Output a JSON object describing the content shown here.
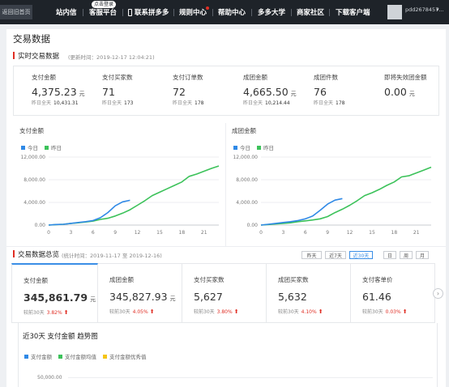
{
  "nav": {
    "home_label": "返回旧首页",
    "items": [
      {
        "label": "站内信"
      },
      {
        "label": "客服平台",
        "badge": "点击登录"
      },
      {
        "label": "联系拼多多"
      },
      {
        "label": "规则中心"
      },
      {
        "label": "帮助中心"
      },
      {
        "label": "多多大学"
      },
      {
        "label": "商家社区"
      },
      {
        "label": "下载客户端"
      }
    ],
    "user_name": "pdd2678457..."
  },
  "page": {
    "title": "交易数据"
  },
  "realtime": {
    "title": "实时交易数据",
    "note": "(更新时间：2019-12-17 12:04:21)",
    "yesterday_label": "昨日全天",
    "metrics": [
      {
        "label": "支付金额",
        "value": "4,375.23",
        "unit": "元",
        "yesterday": "10,431.31"
      },
      {
        "label": "支付买家数",
        "value": "71",
        "unit": "",
        "yesterday": "173"
      },
      {
        "label": "支付订单数",
        "value": "72",
        "unit": "",
        "yesterday": "178"
      },
      {
        "label": "成团金额",
        "value": "4,665.50",
        "unit": "元",
        "yesterday": "10,214.44"
      },
      {
        "label": "成团件数",
        "value": "76",
        "unit": "",
        "yesterday": "178"
      },
      {
        "label": "即将失效团金额",
        "value": "0.00",
        "unit": "元",
        "yesterday": ""
      }
    ]
  },
  "overview": {
    "title": "交易数据总览",
    "note": "(统计时间：2019-11-17 至 2019-12-16)",
    "ranges": [
      "昨天",
      "近7天",
      "近30天",
      "日",
      "周",
      "月"
    ],
    "active_range": "近30天",
    "compare_label": "较前30天",
    "cards": [
      {
        "label": "支付金额",
        "value": "345,861.79",
        "unit": "元",
        "pct": "3.82%"
      },
      {
        "label": "成团金额",
        "value": "345,827.93",
        "unit": "元",
        "pct": "4.05%"
      },
      {
        "label": "支付买家数",
        "value": "5,627",
        "unit": "",
        "pct": "3.80%"
      },
      {
        "label": "成团买家数",
        "value": "5,632",
        "unit": "",
        "pct": "4.10%"
      },
      {
        "label": "支付客单价",
        "value": "61.46",
        "unit": "",
        "pct": "0.03%"
      }
    ]
  },
  "trend": {
    "title": "近30天 支付金额 趋势图",
    "legend": [
      {
        "label": "支付金额",
        "color": "#2f89e6"
      },
      {
        "label": "支付金额均值",
        "color": "#3cc25a"
      },
      {
        "label": "支付金额优秀值",
        "color": "#f5c518"
      }
    ],
    "y_tick": "50,000.00"
  },
  "colors": {
    "today": "#2f89e6",
    "yesterday": "#3cc25a",
    "accent_red": "#e02e24",
    "nav_bg": "#1e2329"
  },
  "chart_data": [
    {
      "type": "line",
      "title": "支付金额",
      "x_ticks": [
        0,
        3,
        6,
        9,
        12,
        15,
        18,
        21
      ],
      "y_ticks": [
        "0.00",
        "4,000.00",
        "8,000.00",
        "12,000.00"
      ],
      "ylim": [
        0,
        12000
      ],
      "xlim": [
        0,
        23
      ],
      "series": [
        {
          "name": "今日",
          "color": "#2f89e6",
          "x": [
            0,
            1,
            2,
            3,
            4,
            5,
            6,
            7,
            8,
            9,
            10,
            11
          ],
          "y": [
            0,
            100,
            150,
            300,
            450,
            600,
            800,
            1300,
            2200,
            3400,
            4100,
            4375
          ]
        },
        {
          "name": "昨日",
          "color": "#3cc25a",
          "x": [
            0,
            1,
            2,
            3,
            4,
            5,
            6,
            7,
            8,
            9,
            10,
            11,
            12,
            13,
            14,
            15,
            16,
            17,
            18,
            19,
            20,
            21,
            22,
            23
          ],
          "y": [
            0,
            80,
            150,
            300,
            400,
            550,
            700,
            1000,
            1200,
            1600,
            2100,
            2700,
            3500,
            4300,
            5200,
            5800,
            6400,
            7000,
            7600,
            8600,
            9000,
            9500,
            10000,
            10430
          ]
        }
      ]
    },
    {
      "type": "line",
      "title": "成团金额",
      "x_ticks": [
        0,
        3,
        6,
        9,
        12,
        15,
        18,
        21
      ],
      "y_ticks": [
        "0.00",
        "4,000.00",
        "8,000.00",
        "12,000.00"
      ],
      "ylim": [
        0,
        12000
      ],
      "xlim": [
        0,
        23
      ],
      "series": [
        {
          "name": "今日",
          "color": "#2f89e6",
          "x": [
            0,
            1,
            2,
            3,
            4,
            5,
            6,
            7,
            8,
            9,
            10,
            11
          ],
          "y": [
            0,
            150,
            300,
            450,
            600,
            800,
            1100,
            1600,
            2600,
            3700,
            4400,
            4665
          ]
        },
        {
          "name": "昨日",
          "color": "#3cc25a",
          "x": [
            0,
            1,
            2,
            3,
            4,
            5,
            6,
            7,
            8,
            9,
            10,
            11,
            12,
            13,
            14,
            15,
            16,
            17,
            18,
            19,
            20,
            21,
            22,
            23
          ],
          "y": [
            0,
            100,
            200,
            300,
            400,
            600,
            750,
            900,
            1100,
            1500,
            2200,
            2800,
            3500,
            4300,
            5200,
            5700,
            6300,
            7000,
            7600,
            8500,
            8700,
            9200,
            9700,
            10214
          ]
        }
      ]
    }
  ]
}
